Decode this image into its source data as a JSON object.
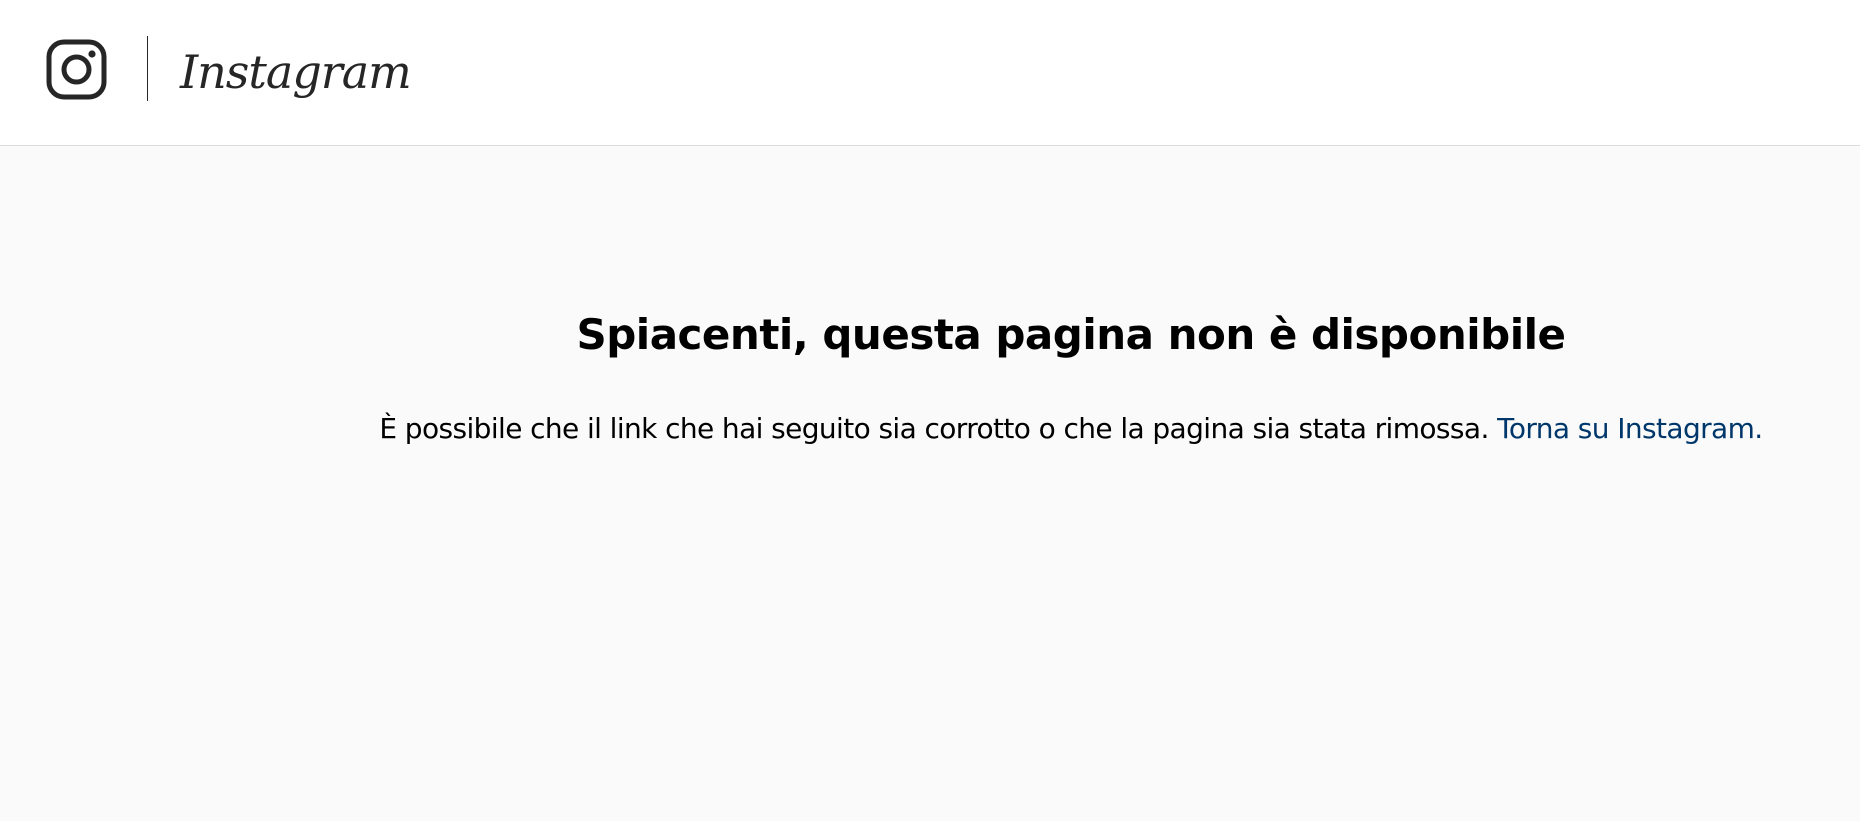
{
  "header": {
    "logo_icon": "instagram-glyph-icon",
    "wordmark": "Instagram"
  },
  "error": {
    "title": "Spiacenti, questa pagina non è disponibile",
    "message": "È possibile che il link che hai seguito sia corrotto o che la pagina sia stata rimossa.",
    "link_text": "Torna su Instagram."
  },
  "colors": {
    "background": "#fafafa",
    "header_background": "#ffffff",
    "link": "#00376b",
    "icon": "#262626",
    "border": "#dbdbdb"
  }
}
